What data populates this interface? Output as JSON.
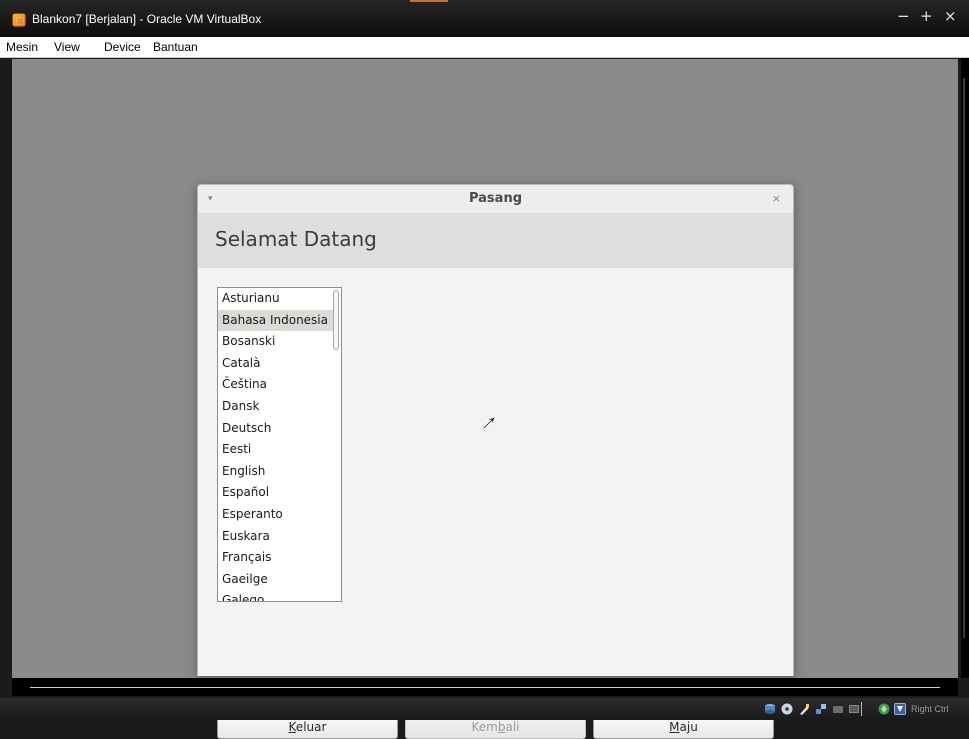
{
  "window": {
    "title": "Blankon7 [Berjalan] - Oracle VM VirtualBox",
    "minimize_glyph": "−",
    "maximize_glyph": "+",
    "close_glyph": "×"
  },
  "menubar": {
    "items": [
      "Mesin",
      "View",
      "Device",
      "Bantuan"
    ]
  },
  "dialog": {
    "title": "Pasang",
    "heading": "Selamat Datang",
    "menu_glyph": "▾",
    "close_glyph": "×",
    "languages": [
      "Asturianu",
      "Bahasa Indonesia",
      "Bosanski",
      "Català",
      "Čeština",
      "Dansk",
      "Deutsch",
      "Eesti",
      "English",
      "Español",
      "Esperanto",
      "Euskara",
      "Français",
      "Gaeilge",
      "Galego"
    ],
    "selected_language": "Bahasa Indonesia",
    "buttons": {
      "quit": {
        "pre": "",
        "mnemonic": "K",
        "post": "eluar",
        "enabled": true
      },
      "back": {
        "pre": "Kem",
        "mnemonic": "b",
        "post": "ali",
        "enabled": false
      },
      "forward": {
        "pre": "",
        "mnemonic": "M",
        "post": "aju",
        "enabled": true
      }
    }
  },
  "statusbar": {
    "host_key": "Right Ctrl",
    "icons": [
      "hard-disk-icon",
      "optical-drive-icon",
      "usb-icon",
      "network-icon",
      "shared-folder-icon",
      "display-icon",
      "virtualization-icon",
      "mouse-integration-icon"
    ]
  },
  "colors": {
    "vm_background": "#8a8a8a",
    "dialog_header": "#dedede",
    "selected_row": "#d8dcd6",
    "title_accent": "#d36a2a"
  }
}
